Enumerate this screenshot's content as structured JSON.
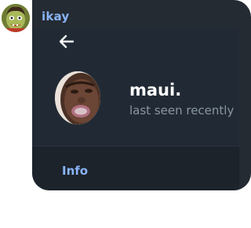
{
  "message": {
    "sender_name": "ikay",
    "sender_avatar_icon": "cartoon-avatar-icon"
  },
  "screenshot": {
    "back_icon": "arrow-left-icon",
    "profile": {
      "display_name": "maui.",
      "status": "last seen recently",
      "photo_icon": "profile-photo"
    },
    "section_title": "Info"
  },
  "colors": {
    "bubble_bg": "#252b33",
    "header_bg": "#212a34",
    "accent": "#8ab4f8",
    "muted_text": "#8a96a3"
  }
}
